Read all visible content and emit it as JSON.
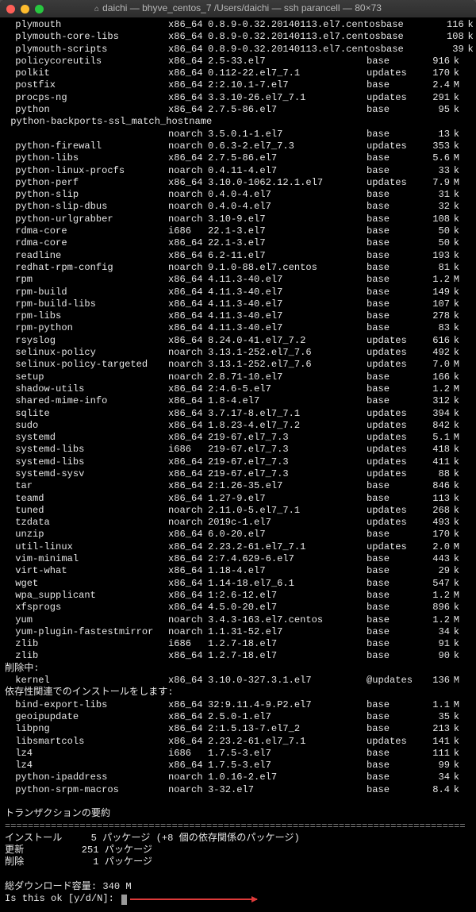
{
  "window_title": "daichi — bhyve_centos_7 /Users/daichi — ssh parancell — 80×73",
  "packages_main": [
    {
      "name": "plymouth",
      "arch": "x86_64",
      "ver": "0.8.9-0.32.20140113.el7.centos",
      "repo": "base",
      "size": "116",
      "unit": "k"
    },
    {
      "name": "plymouth-core-libs",
      "arch": "x86_64",
      "ver": "0.8.9-0.32.20140113.el7.centos",
      "repo": "base",
      "size": "108",
      "unit": "k"
    },
    {
      "name": "plymouth-scripts",
      "arch": "x86_64",
      "ver": "0.8.9-0.32.20140113.el7.centos",
      "repo": "base",
      "size": "39",
      "unit": "k"
    },
    {
      "name": "policycoreutils",
      "arch": "x86_64",
      "ver": "2.5-33.el7",
      "repo": "base",
      "size": "916",
      "unit": "k"
    },
    {
      "name": "polkit",
      "arch": "x86_64",
      "ver": "0.112-22.el7_7.1",
      "repo": "updates",
      "size": "170",
      "unit": "k"
    },
    {
      "name": "postfix",
      "arch": "x86_64",
      "ver": "2:2.10.1-7.el7",
      "repo": "base",
      "size": "2.4",
      "unit": "M"
    },
    {
      "name": "procps-ng",
      "arch": "x86_64",
      "ver": "3.3.10-26.el7_7.1",
      "repo": "updates",
      "size": "291",
      "unit": "k"
    },
    {
      "name": "python",
      "arch": "x86_64",
      "ver": "2.7.5-86.el7",
      "repo": "base",
      "size": "95",
      "unit": "k"
    }
  ],
  "wrapped_pkg": {
    "name": "python-backports-ssl_match_hostname",
    "arch": "noarch",
    "ver": "3.5.0.1-1.el7",
    "repo": "base",
    "size": "13",
    "unit": "k"
  },
  "packages_cont": [
    {
      "name": "python-firewall",
      "arch": "noarch",
      "ver": "0.6.3-2.el7_7.3",
      "repo": "updates",
      "size": "353",
      "unit": "k"
    },
    {
      "name": "python-libs",
      "arch": "x86_64",
      "ver": "2.7.5-86.el7",
      "repo": "base",
      "size": "5.6",
      "unit": "M"
    },
    {
      "name": "python-linux-procfs",
      "arch": "noarch",
      "ver": "0.4.11-4.el7",
      "repo": "base",
      "size": "33",
      "unit": "k"
    },
    {
      "name": "python-perf",
      "arch": "x86_64",
      "ver": "3.10.0-1062.12.1.el7",
      "repo": "updates",
      "size": "7.9",
      "unit": "M"
    },
    {
      "name": "python-slip",
      "arch": "noarch",
      "ver": "0.4.0-4.el7",
      "repo": "base",
      "size": "31",
      "unit": "k"
    },
    {
      "name": "python-slip-dbus",
      "arch": "noarch",
      "ver": "0.4.0-4.el7",
      "repo": "base",
      "size": "32",
      "unit": "k"
    },
    {
      "name": "python-urlgrabber",
      "arch": "noarch",
      "ver": "3.10-9.el7",
      "repo": "base",
      "size": "108",
      "unit": "k"
    },
    {
      "name": "rdma-core",
      "arch": "i686",
      "ver": "22.1-3.el7",
      "repo": "base",
      "size": "50",
      "unit": "k"
    },
    {
      "name": "rdma-core",
      "arch": "x86_64",
      "ver": "22.1-3.el7",
      "repo": "base",
      "size": "50",
      "unit": "k"
    },
    {
      "name": "readline",
      "arch": "x86_64",
      "ver": "6.2-11.el7",
      "repo": "base",
      "size": "193",
      "unit": "k"
    },
    {
      "name": "redhat-rpm-config",
      "arch": "noarch",
      "ver": "9.1.0-88.el7.centos",
      "repo": "base",
      "size": "81",
      "unit": "k"
    },
    {
      "name": "rpm",
      "arch": "x86_64",
      "ver": "4.11.3-40.el7",
      "repo": "base",
      "size": "1.2",
      "unit": "M"
    },
    {
      "name": "rpm-build",
      "arch": "x86_64",
      "ver": "4.11.3-40.el7",
      "repo": "base",
      "size": "149",
      "unit": "k"
    },
    {
      "name": "rpm-build-libs",
      "arch": "x86_64",
      "ver": "4.11.3-40.el7",
      "repo": "base",
      "size": "107",
      "unit": "k"
    },
    {
      "name": "rpm-libs",
      "arch": "x86_64",
      "ver": "4.11.3-40.el7",
      "repo": "base",
      "size": "278",
      "unit": "k"
    },
    {
      "name": "rpm-python",
      "arch": "x86_64",
      "ver": "4.11.3-40.el7",
      "repo": "base",
      "size": "83",
      "unit": "k"
    },
    {
      "name": "rsyslog",
      "arch": "x86_64",
      "ver": "8.24.0-41.el7_7.2",
      "repo": "updates",
      "size": "616",
      "unit": "k"
    },
    {
      "name": "selinux-policy",
      "arch": "noarch",
      "ver": "3.13.1-252.el7_7.6",
      "repo": "updates",
      "size": "492",
      "unit": "k"
    },
    {
      "name": "selinux-policy-targeted",
      "arch": "noarch",
      "ver": "3.13.1-252.el7_7.6",
      "repo": "updates",
      "size": "7.0",
      "unit": "M"
    },
    {
      "name": "setup",
      "arch": "noarch",
      "ver": "2.8.71-10.el7",
      "repo": "base",
      "size": "166",
      "unit": "k"
    },
    {
      "name": "shadow-utils",
      "arch": "x86_64",
      "ver": "2:4.6-5.el7",
      "repo": "base",
      "size": "1.2",
      "unit": "M"
    },
    {
      "name": "shared-mime-info",
      "arch": "x86_64",
      "ver": "1.8-4.el7",
      "repo": "base",
      "size": "312",
      "unit": "k"
    },
    {
      "name": "sqlite",
      "arch": "x86_64",
      "ver": "3.7.17-8.el7_7.1",
      "repo": "updates",
      "size": "394",
      "unit": "k"
    },
    {
      "name": "sudo",
      "arch": "x86_64",
      "ver": "1.8.23-4.el7_7.2",
      "repo": "updates",
      "size": "842",
      "unit": "k"
    },
    {
      "name": "systemd",
      "arch": "x86_64",
      "ver": "219-67.el7_7.3",
      "repo": "updates",
      "size": "5.1",
      "unit": "M"
    },
    {
      "name": "systemd-libs",
      "arch": "i686",
      "ver": "219-67.el7_7.3",
      "repo": "updates",
      "size": "418",
      "unit": "k"
    },
    {
      "name": "systemd-libs",
      "arch": "x86_64",
      "ver": "219-67.el7_7.3",
      "repo": "updates",
      "size": "411",
      "unit": "k"
    },
    {
      "name": "systemd-sysv",
      "arch": "x86_64",
      "ver": "219-67.el7_7.3",
      "repo": "updates",
      "size": "88",
      "unit": "k"
    },
    {
      "name": "tar",
      "arch": "x86_64",
      "ver": "2:1.26-35.el7",
      "repo": "base",
      "size": "846",
      "unit": "k"
    },
    {
      "name": "teamd",
      "arch": "x86_64",
      "ver": "1.27-9.el7",
      "repo": "base",
      "size": "113",
      "unit": "k"
    },
    {
      "name": "tuned",
      "arch": "noarch",
      "ver": "2.11.0-5.el7_7.1",
      "repo": "updates",
      "size": "268",
      "unit": "k"
    },
    {
      "name": "tzdata",
      "arch": "noarch",
      "ver": "2019c-1.el7",
      "repo": "updates",
      "size": "493",
      "unit": "k"
    },
    {
      "name": "unzip",
      "arch": "x86_64",
      "ver": "6.0-20.el7",
      "repo": "base",
      "size": "170",
      "unit": "k"
    },
    {
      "name": "util-linux",
      "arch": "x86_64",
      "ver": "2.23.2-61.el7_7.1",
      "repo": "updates",
      "size": "2.0",
      "unit": "M"
    },
    {
      "name": "vim-minimal",
      "arch": "x86_64",
      "ver": "2:7.4.629-6.el7",
      "repo": "base",
      "size": "443",
      "unit": "k"
    },
    {
      "name": "virt-what",
      "arch": "x86_64",
      "ver": "1.18-4.el7",
      "repo": "base",
      "size": "29",
      "unit": "k"
    },
    {
      "name": "wget",
      "arch": "x86_64",
      "ver": "1.14-18.el7_6.1",
      "repo": "base",
      "size": "547",
      "unit": "k"
    },
    {
      "name": "wpa_supplicant",
      "arch": "x86_64",
      "ver": "1:2.6-12.el7",
      "repo": "base",
      "size": "1.2",
      "unit": "M"
    },
    {
      "name": "xfsprogs",
      "arch": "x86_64",
      "ver": "4.5.0-20.el7",
      "repo": "base",
      "size": "896",
      "unit": "k"
    },
    {
      "name": "yum",
      "arch": "noarch",
      "ver": "3.4.3-163.el7.centos",
      "repo": "base",
      "size": "1.2",
      "unit": "M"
    },
    {
      "name": "yum-plugin-fastestmirror",
      "arch": "noarch",
      "ver": "1.1.31-52.el7",
      "repo": "base",
      "size": "34",
      "unit": "k"
    },
    {
      "name": "zlib",
      "arch": "i686",
      "ver": "1.2.7-18.el7",
      "repo": "base",
      "size": "91",
      "unit": "k"
    },
    {
      "name": "zlib",
      "arch": "x86_64",
      "ver": "1.2.7-18.el7",
      "repo": "base",
      "size": "90",
      "unit": "k"
    }
  ],
  "removing_label": "削除中:",
  "removing": [
    {
      "name": "kernel",
      "arch": "x86_64",
      "ver": "3.10.0-327.3.1.el7",
      "repo": "@updates",
      "size": "136",
      "unit": "M"
    }
  ],
  "deps_label": "依存性関連でのインストールをします:",
  "deps": [
    {
      "name": "bind-export-libs",
      "arch": "x86_64",
      "ver": "32:9.11.4-9.P2.el7",
      "repo": "base",
      "size": "1.1",
      "unit": "M"
    },
    {
      "name": "geoipupdate",
      "arch": "x86_64",
      "ver": "2.5.0-1.el7",
      "repo": "base",
      "size": "35",
      "unit": "k"
    },
    {
      "name": "libpng",
      "arch": "x86_64",
      "ver": "2:1.5.13-7.el7_2",
      "repo": "base",
      "size": "213",
      "unit": "k"
    },
    {
      "name": "libsmartcols",
      "arch": "x86_64",
      "ver": "2.23.2-61.el7_7.1",
      "repo": "updates",
      "size": "141",
      "unit": "k"
    },
    {
      "name": "lz4",
      "arch": "i686",
      "ver": "1.7.5-3.el7",
      "repo": "base",
      "size": "111",
      "unit": "k"
    },
    {
      "name": "lz4",
      "arch": "x86_64",
      "ver": "1.7.5-3.el7",
      "repo": "base",
      "size": "99",
      "unit": "k"
    },
    {
      "name": "python-ipaddress",
      "arch": "noarch",
      "ver": "1.0.16-2.el7",
      "repo": "base",
      "size": "34",
      "unit": "k"
    },
    {
      "name": "python-srpm-macros",
      "arch": "noarch",
      "ver": "3-32.el7",
      "repo": "base",
      "size": "8.4",
      "unit": "k"
    }
  ],
  "summary_title": "トランザクションの要約",
  "summary_lines": [
    "インストール     5 パッケージ (+8 個の依存関係のパッケージ)",
    "更新          251 パッケージ",
    "削除            1 パッケージ"
  ],
  "download_line": "総ダウンロード容量: 340 M",
  "prompt_line": "Is this ok [y/d/N]: "
}
